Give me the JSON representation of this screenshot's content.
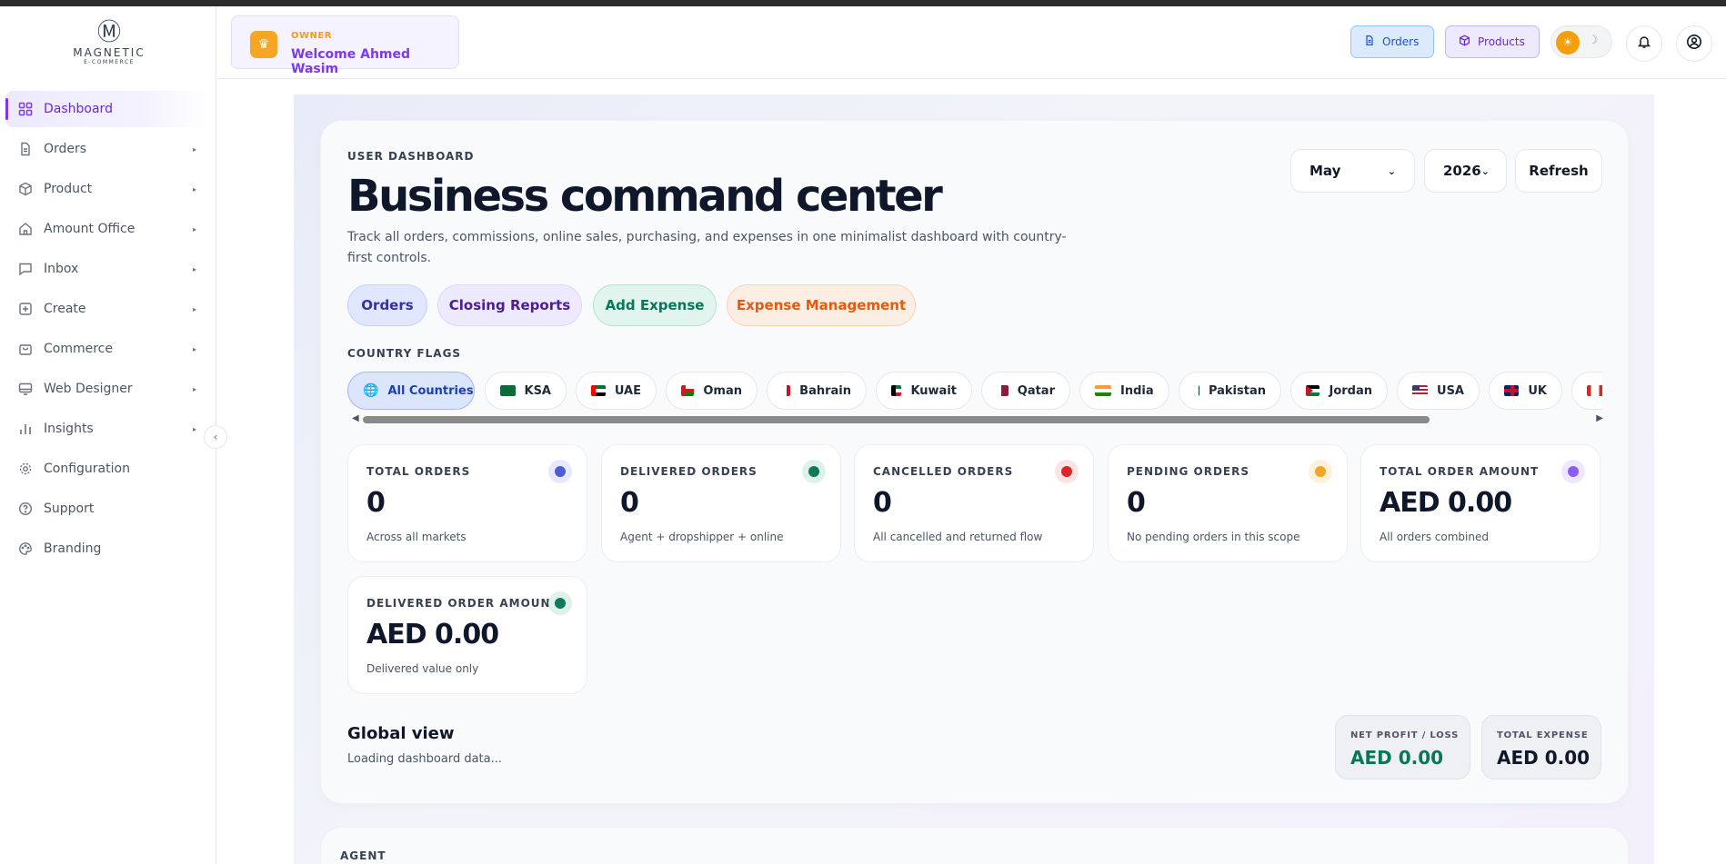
{
  "brand": {
    "name": "MAGNETIC",
    "tagline": "E-COMMERCE"
  },
  "sidebar": {
    "items": [
      {
        "label": "Dashboard",
        "icon": "grid-icon",
        "active": true
      },
      {
        "label": "Orders",
        "icon": "document-icon"
      },
      {
        "label": "Product",
        "icon": "cube-icon"
      },
      {
        "label": "Amount Office",
        "icon": "home-icon"
      },
      {
        "label": "Inbox",
        "icon": "chat-icon"
      },
      {
        "label": "Create",
        "icon": "plus-square-icon"
      },
      {
        "label": "Commerce",
        "icon": "bag-icon"
      },
      {
        "label": "Web Designer",
        "icon": "monitor-icon"
      },
      {
        "label": "Insights",
        "icon": "bar-chart-icon"
      },
      {
        "label": "Configuration",
        "icon": "gear-icon"
      },
      {
        "label": "Support",
        "icon": "help-circle-icon"
      },
      {
        "label": "Branding",
        "icon": "palette-icon"
      }
    ]
  },
  "header": {
    "role": "OWNER",
    "welcome": "Welcome Ahmed Wasim",
    "orders_btn": "Orders",
    "products_btn": "Products"
  },
  "dashboard": {
    "eyebrow": "USER DASHBOARD",
    "title": "Business command center",
    "description": "Track all orders, commissions, online sales, purchasing, and expenses in one minimalist dashboard with country-first controls.",
    "actions": {
      "orders": "Orders",
      "closing": "Closing Reports",
      "add_expense": "Add Expense",
      "expense_mgmt": "Expense Management"
    },
    "filters": {
      "month": "May",
      "year": "2026",
      "refresh": "Refresh"
    },
    "flags_label": "COUNTRY FLAGS",
    "countries": [
      "All Countries",
      "KSA",
      "UAE",
      "Oman",
      "Bahrain",
      "Kuwait",
      "Qatar",
      "India",
      "Pakistan",
      "Jordan",
      "USA",
      "UK",
      ""
    ],
    "stats": [
      {
        "label": "TOTAL ORDERS",
        "value": "0",
        "sub": "Across all markets",
        "color": "#4f5bd5",
        "bg": "#e7e9fb"
      },
      {
        "label": "DELIVERED ORDERS",
        "value": "0",
        "sub": "Agent + dropshipper + online",
        "color": "#0f7a5a",
        "bg": "#def2ea"
      },
      {
        "label": "CANCELLED ORDERS",
        "value": "0",
        "sub": "All cancelled and returned flow",
        "color": "#dc2626",
        "bg": "#fde4e4"
      },
      {
        "label": "PENDING ORDERS",
        "value": "0",
        "sub": "No pending orders in this scope",
        "color": "#f5a524",
        "bg": "#fdf1dc"
      },
      {
        "label": "TOTAL ORDER AMOUNT",
        "value": "AED 0.00",
        "sub": "All orders combined",
        "color": "#8b5cf6",
        "bg": "#eee7fd"
      },
      {
        "label": "DELIVERED ORDER AMOUNT",
        "value": "AED 0.00",
        "sub": "Delivered value only",
        "color": "#0f7a5a",
        "bg": "#def2ea"
      }
    ],
    "global_title": "Global view",
    "global_status": "Loading dashboard data...",
    "net_label": "NET PROFIT / LOSS",
    "net_value": "AED 0.00",
    "net_color": "#047857",
    "expense_label": "TOTAL EXPENSE",
    "expense_value": "AED 0.00"
  },
  "agent_section": {
    "label": "AGENT"
  }
}
